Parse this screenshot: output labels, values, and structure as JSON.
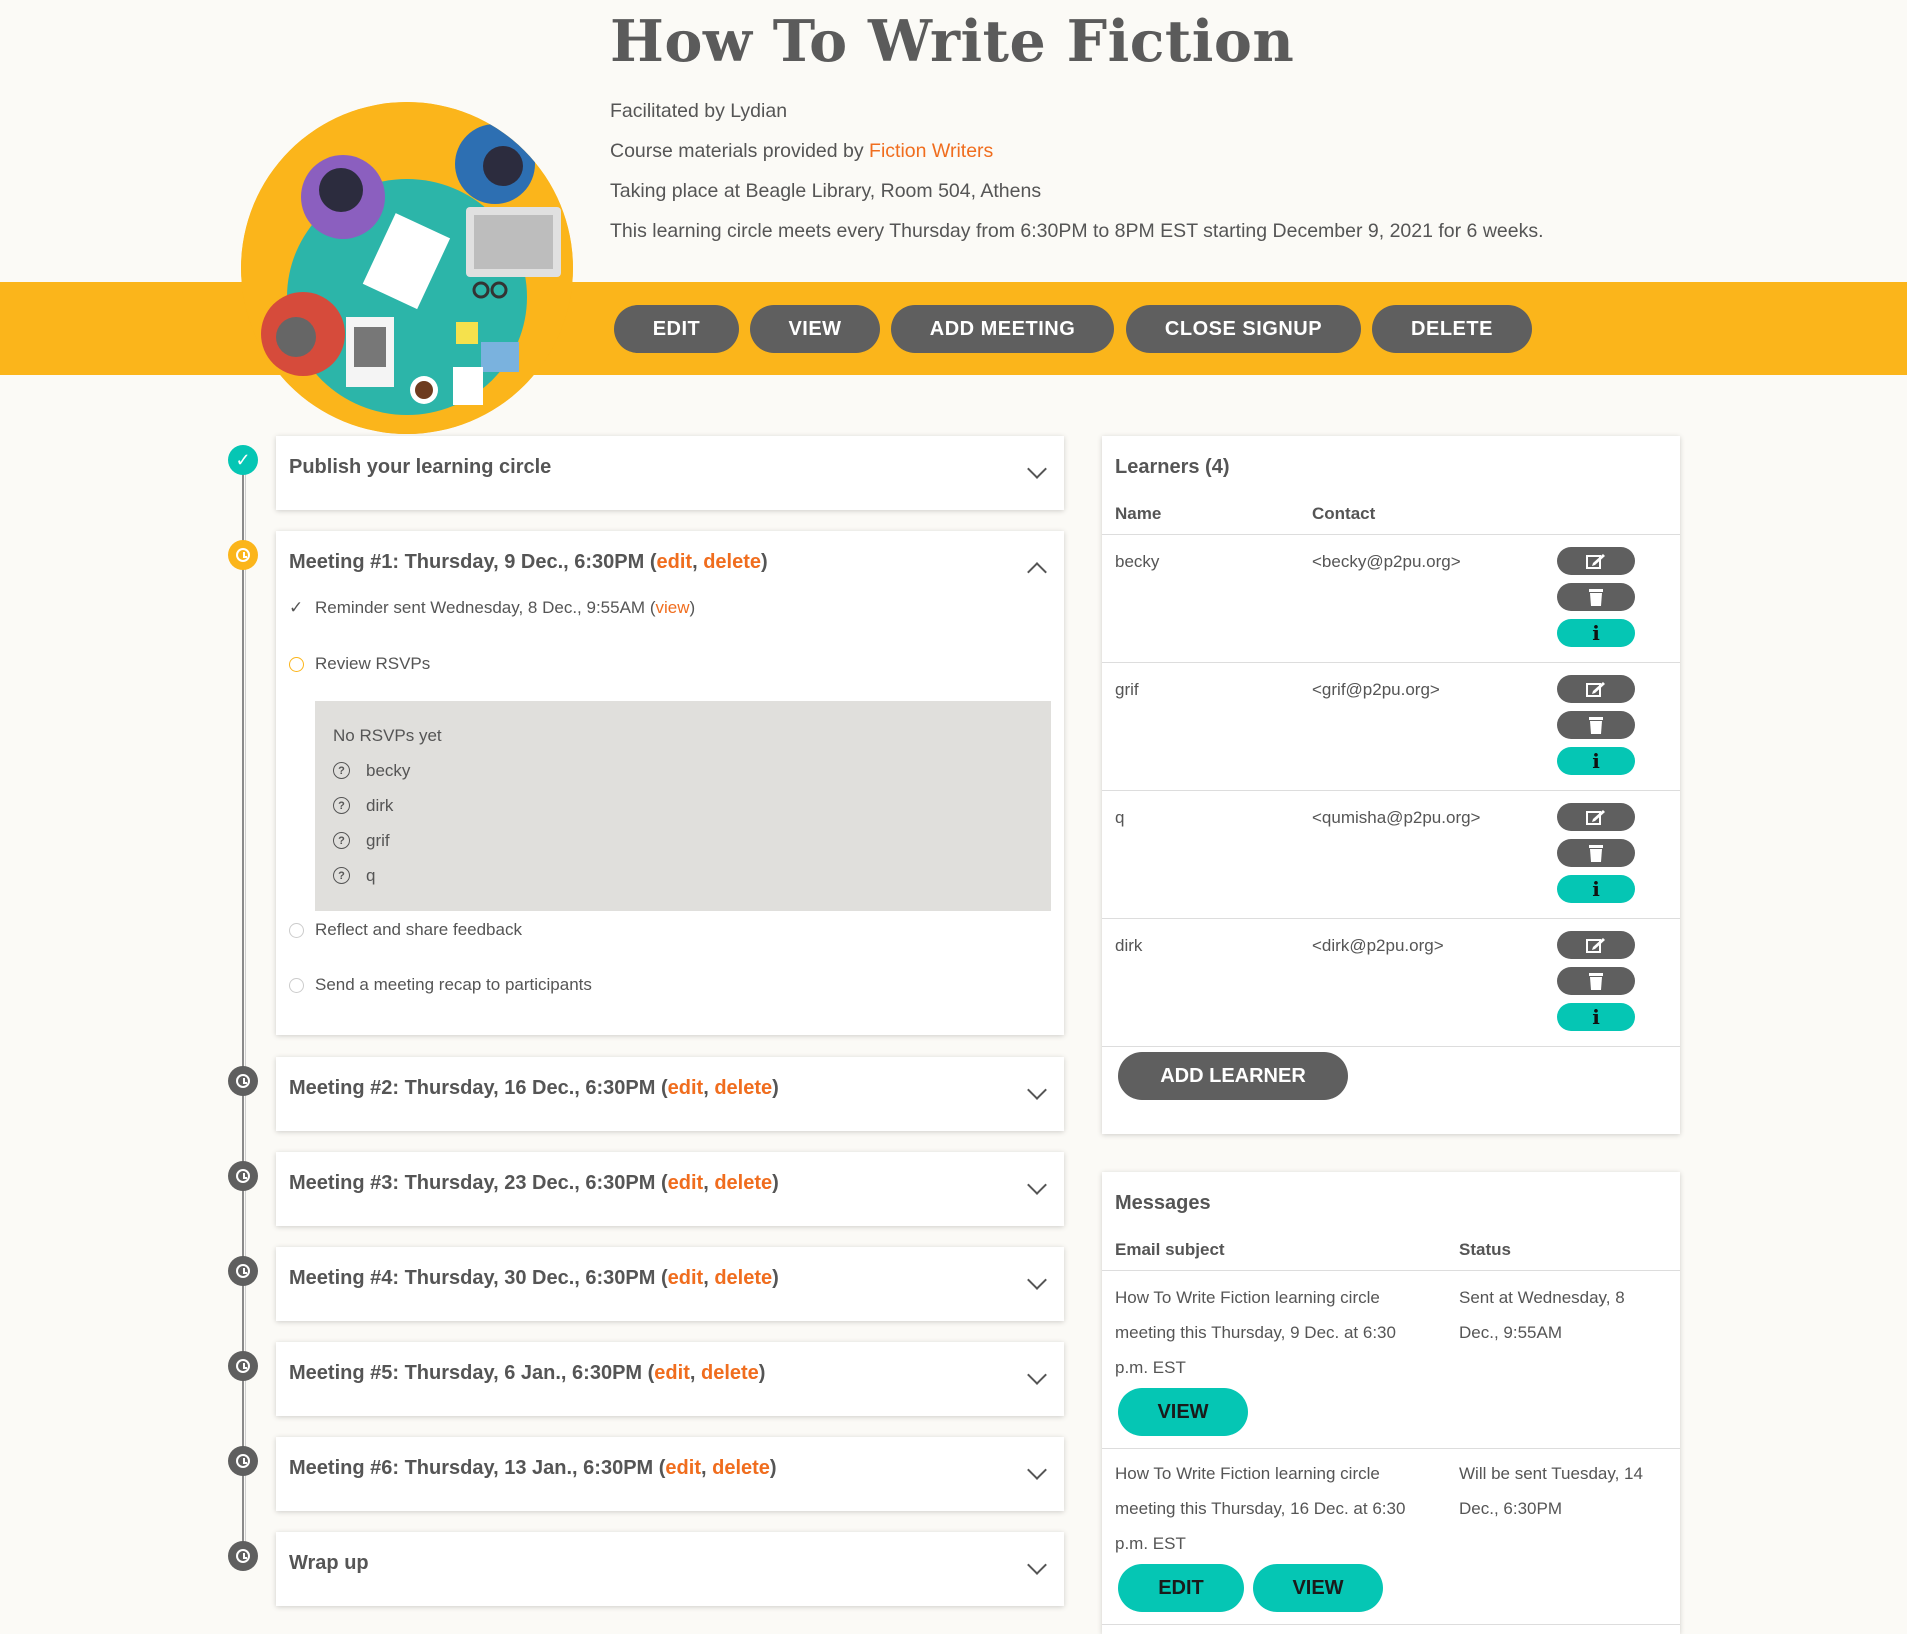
{
  "title": "How To Write Fiction",
  "facilitated": "Facilitated by Lydian",
  "materials_prefix": "Course materials provided by ",
  "materials_link": "Fiction Writers",
  "location": "Taking place at Beagle Library, Room 504, Athens",
  "schedule": "This learning circle meets every Thursday from 6:30PM to 8PM EST starting December 9, 2021 for 6 weeks.",
  "actions": {
    "edit": "EDIT",
    "view": "VIEW",
    "add_meeting": "ADD MEETING",
    "close_signup": "CLOSE SIGNUP",
    "delete": "DELETE"
  },
  "timeline": {
    "publish": "Publish your learning circle",
    "meeting1": {
      "title": "Meeting #1: Thursday, 9 Dec., 6:30PM",
      "edit": "edit",
      "delete": "delete",
      "reminder": "Reminder sent Wednesday, 8 Dec., 9:55AM",
      "reminder_view": "view",
      "review": "Review RSVPs",
      "no_rsvps": "No RSVPs yet",
      "rsvps": [
        "becky",
        "dirk",
        "grif",
        "q"
      ],
      "reflect": "Reflect and share feedback",
      "recap": "Send a meeting recap to participants"
    },
    "meetings": [
      {
        "title": "Meeting #2: Thursday, 16 Dec., 6:30PM",
        "edit": "edit",
        "delete": "delete"
      },
      {
        "title": "Meeting #3: Thursday, 23 Dec., 6:30PM",
        "edit": "edit",
        "delete": "delete"
      },
      {
        "title": "Meeting #4: Thursday, 30 Dec., 6:30PM",
        "edit": "edit",
        "delete": "delete"
      },
      {
        "title": "Meeting #5: Thursday, 6 Jan., 6:30PM",
        "edit": "edit",
        "delete": "delete"
      },
      {
        "title": "Meeting #6: Thursday, 13 Jan., 6:30PM",
        "edit": "edit",
        "delete": "delete"
      }
    ],
    "wrap_up": "Wrap up"
  },
  "learners": {
    "heading": "Learners (4)",
    "col_name": "Name",
    "col_contact": "Contact",
    "rows": [
      {
        "name": "becky",
        "contact": "<becky@p2pu.org>"
      },
      {
        "name": "grif",
        "contact": "<grif@p2pu.org>"
      },
      {
        "name": "q",
        "contact": "<qumisha@p2pu.org>"
      },
      {
        "name": "dirk",
        "contact": "<dirk@p2pu.org>"
      }
    ],
    "add_button": "ADD LEARNER",
    "info_glyph": "i"
  },
  "messages": {
    "heading": "Messages",
    "col_subject": "Email subject",
    "col_status": "Status",
    "rows": [
      {
        "subject": "How To Write Fiction learning circle meeting this Thursday, 9 Dec. at 6:30 p.m. EST",
        "status": "Sent at Wednesday, 8 Dec., 9:55AM",
        "view": "VIEW"
      },
      {
        "subject": "How To Write Fiction learning circle meeting this Thursday, 16 Dec. at 6:30 p.m. EST",
        "status": "Will be sent Tuesday, 14 Dec., 6:30PM",
        "edit": "EDIT",
        "view": "VIEW"
      }
    ]
  },
  "colors": {
    "accent_yellow": "#fbb51b",
    "button_gray": "#5f5f5f",
    "teal": "#05c6b4",
    "link_orange": "#f06d1e"
  }
}
